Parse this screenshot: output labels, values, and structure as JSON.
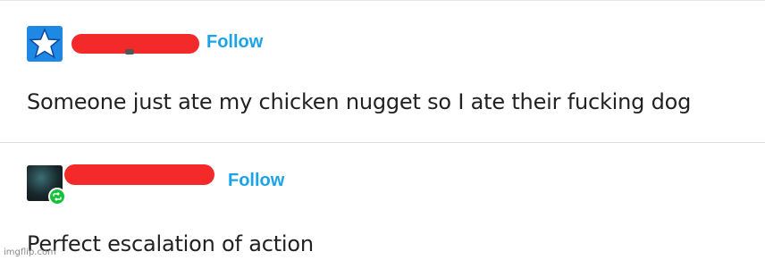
{
  "posts": [
    {
      "avatar_icon": "star-icon",
      "avatar_color": "#1e88e5",
      "follow_label": "Follow",
      "text": "Someone just ate my chicken nugget so I ate their fucking dog"
    },
    {
      "avatar_icon": "reblog-icon",
      "badge_color": "#16c23a",
      "follow_label": "Follow",
      "text": "Perfect escalation of action"
    }
  ],
  "colors": {
    "follow": "#1aa3e8",
    "redaction": "#f42a2a",
    "text": "#222222"
  },
  "watermark": "imgflip.com"
}
